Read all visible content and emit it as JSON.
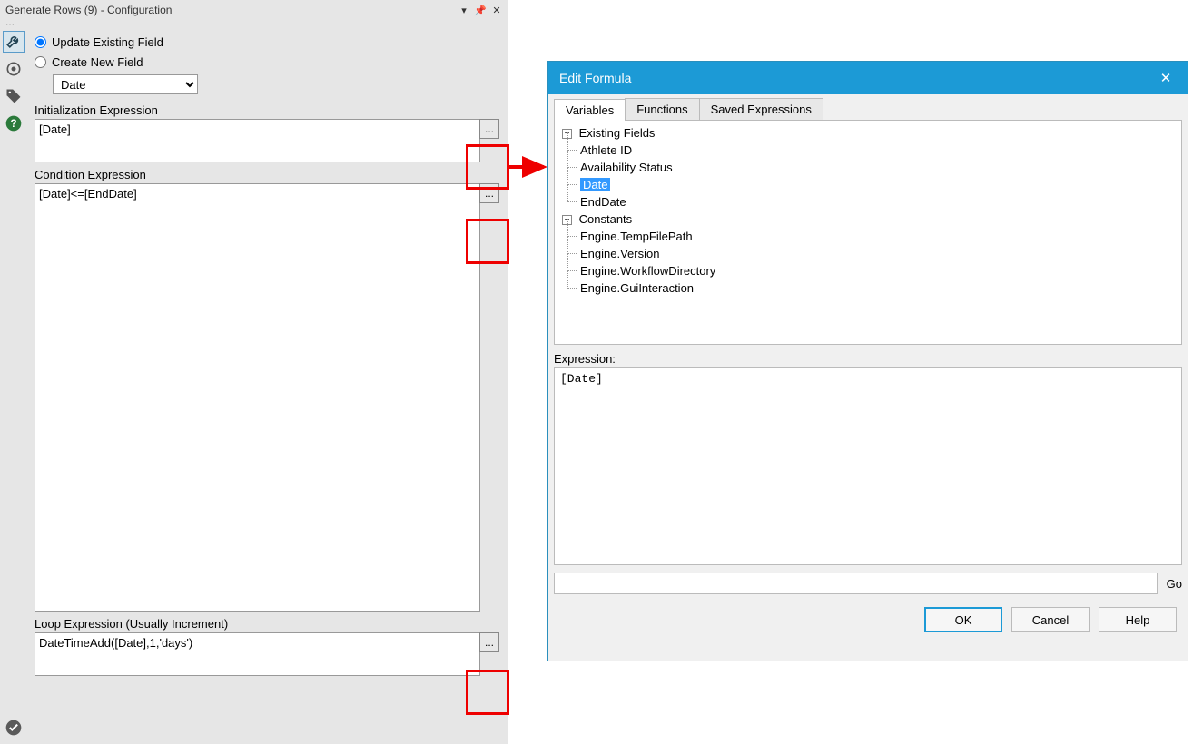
{
  "config": {
    "title": "Generate Rows (9) - Configuration",
    "radio_update": "Update Existing Field",
    "radio_create": "Create New  Field",
    "field_select_value": "Date",
    "sections": {
      "init_label": "Initialization Expression",
      "init_value": "[Date]",
      "cond_label": "Condition Expression",
      "cond_value": "[Date]<=[EndDate]",
      "loop_label": "Loop Expression (Usually Increment)",
      "loop_value": "DateTimeAdd([Date],1,'days')"
    },
    "ellipsis_label": "..."
  },
  "dialog": {
    "title": "Edit Formula",
    "tabs": {
      "variables": "Variables",
      "functions": "Functions",
      "saved": "Saved Expressions"
    },
    "tree": {
      "existing_fields_label": "Existing Fields",
      "fields": {
        "athlete_id": "Athlete ID",
        "availability_status": "Availability Status",
        "date": "Date",
        "end_date": "EndDate"
      },
      "constants_label": "Constants",
      "constants": {
        "temp": "Engine.TempFilePath",
        "version": "Engine.Version",
        "workflow": "Engine.WorkflowDirectory",
        "gui": "Engine.GuiInteraction"
      }
    },
    "expression_label": "Expression:",
    "expression_value": "[Date]",
    "go_label": "Go",
    "buttons": {
      "ok": "OK",
      "cancel": "Cancel",
      "help": "Help"
    }
  }
}
